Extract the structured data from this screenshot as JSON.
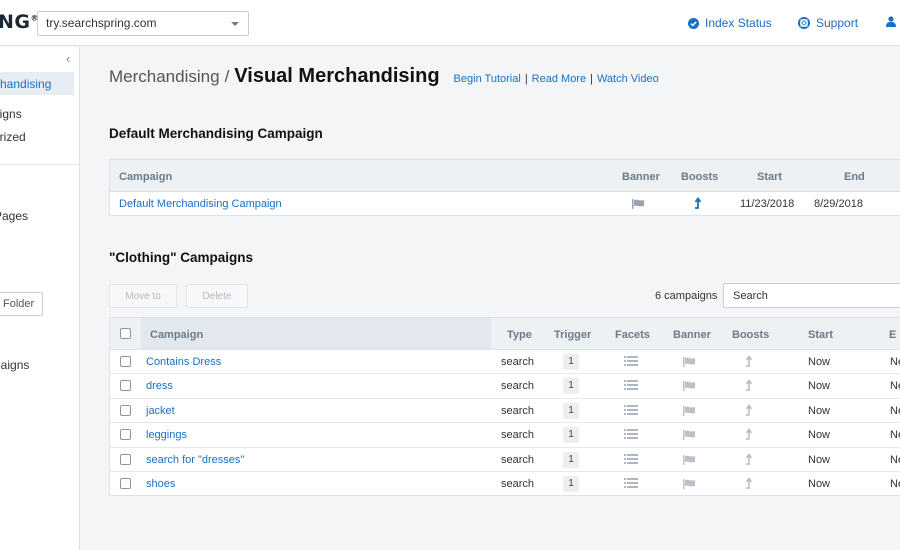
{
  "topbar": {
    "logo": "NG",
    "site": "try.searchspring.com",
    "index_status": "Index Status",
    "support": "Support"
  },
  "sidebar": {
    "items": [
      {
        "label": "chandising",
        "active": true
      },
      {
        "label": "aigns"
      },
      {
        "label": "orized"
      },
      {
        "label": "Pages"
      },
      {
        "label": "paigns"
      }
    ],
    "folder_button": "Folder"
  },
  "header": {
    "breadcrumb": "Merchandising",
    "separator": "/",
    "title": "Visual Merchandising",
    "links": [
      "Begin Tutorial",
      "Read More",
      "Watch Video"
    ],
    "link_sep": "|"
  },
  "default_section": {
    "title": "Default Merchandising Campaign",
    "columns": [
      "Campaign",
      "Banner",
      "Boosts",
      "Start",
      "End"
    ],
    "row": {
      "campaign": "Default Merchandising Campaign",
      "start": "11/23/2018",
      "end": "8/29/2018"
    }
  },
  "clothing_section": {
    "title": "\"Clothing\" Campaigns",
    "move_to": "Move to",
    "delete": "Delete",
    "count": "6 campaigns",
    "search_value": "Search",
    "columns": [
      "Campaign",
      "Type",
      "Trigger",
      "Facets",
      "Banner",
      "Boosts",
      "Start",
      "E"
    ],
    "rows": [
      {
        "campaign": "Contains Dress",
        "type": "search",
        "trigger": "1",
        "start": "Now",
        "end": "Ne"
      },
      {
        "campaign": "dress",
        "type": "search",
        "trigger": "1",
        "start": "Now",
        "end": "Ne"
      },
      {
        "campaign": "jacket",
        "type": "search",
        "trigger": "1",
        "start": "Now",
        "end": "Ne"
      },
      {
        "campaign": "leggings",
        "type": "search",
        "trigger": "1",
        "start": "Now",
        "end": "Ne"
      },
      {
        "campaign": "search for \"dresses\"",
        "type": "search",
        "trigger": "1",
        "start": "Now",
        "end": "Ne"
      },
      {
        "campaign": "shoes",
        "type": "search",
        "trigger": "1",
        "start": "Now",
        "end": "Ne"
      }
    ]
  },
  "colors": {
    "link": "#1a6fc4",
    "header_bg": "#eef1f4",
    "page_bg": "#f4f5f7"
  }
}
